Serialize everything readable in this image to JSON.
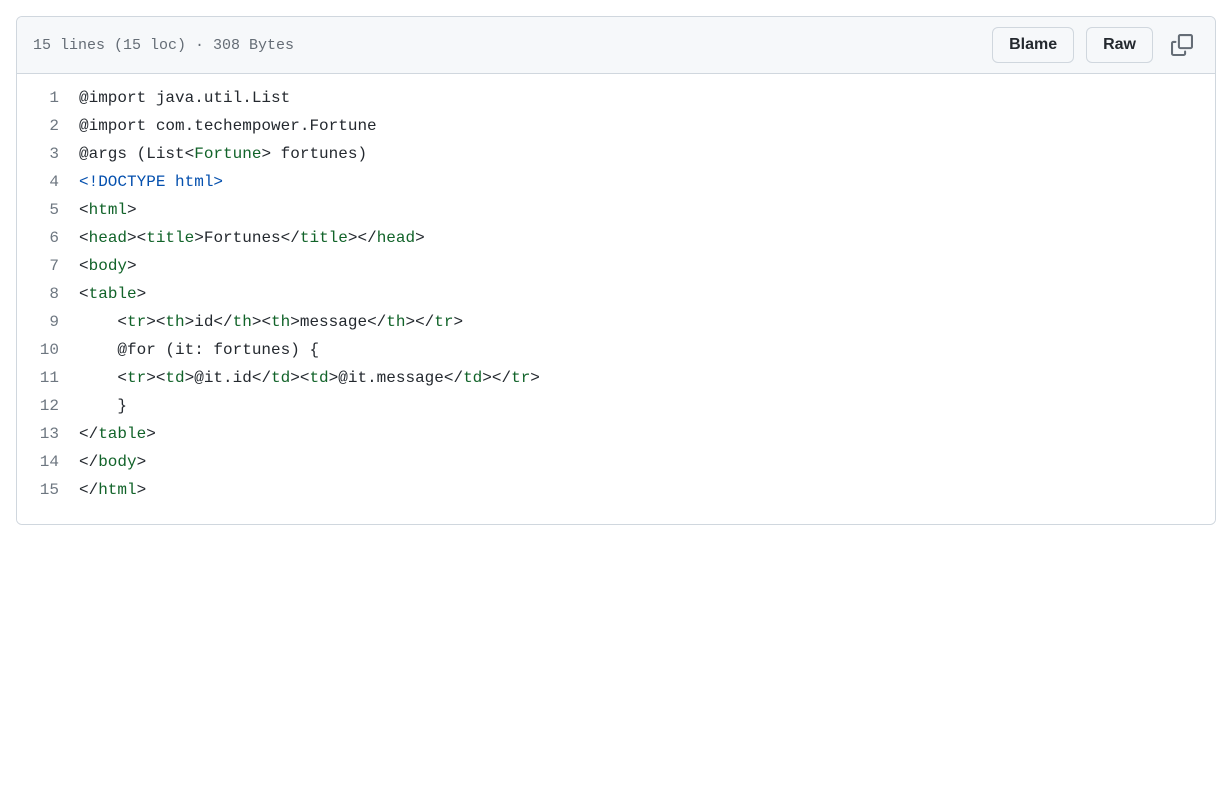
{
  "header": {
    "info_text": "15 lines (15 loc) · 308 Bytes",
    "blame_label": "Blame",
    "raw_label": "Raw"
  },
  "code": {
    "line_count": 15,
    "lines": [
      {
        "num": "1",
        "indent": "",
        "tokens": [
          {
            "t": "txt",
            "v": "@import java.util.List"
          }
        ]
      },
      {
        "num": "2",
        "indent": "",
        "tokens": [
          {
            "t": "txt",
            "v": "@import com.techempower.Fortune"
          }
        ]
      },
      {
        "num": "3",
        "indent": "",
        "tokens": [
          {
            "t": "txt",
            "v": "@args (List<"
          },
          {
            "t": "ent",
            "v": "Fortune"
          },
          {
            "t": "txt",
            "v": "> fortunes)"
          }
        ]
      },
      {
        "num": "4",
        "indent": "",
        "tokens": [
          {
            "t": "doc",
            "v": "<!DOCTYPE html>"
          }
        ]
      },
      {
        "num": "5",
        "indent": "",
        "tokens": [
          {
            "t": "txt",
            "v": "<"
          },
          {
            "t": "ent",
            "v": "html"
          },
          {
            "t": "txt",
            "v": ">"
          }
        ]
      },
      {
        "num": "6",
        "indent": "",
        "tokens": [
          {
            "t": "txt",
            "v": "<"
          },
          {
            "t": "ent",
            "v": "head"
          },
          {
            "t": "txt",
            "v": "><"
          },
          {
            "t": "ent",
            "v": "title"
          },
          {
            "t": "txt",
            "v": ">Fortunes</"
          },
          {
            "t": "ent",
            "v": "title"
          },
          {
            "t": "txt",
            "v": "></"
          },
          {
            "t": "ent",
            "v": "head"
          },
          {
            "t": "txt",
            "v": ">"
          }
        ]
      },
      {
        "num": "7",
        "indent": "",
        "tokens": [
          {
            "t": "txt",
            "v": "<"
          },
          {
            "t": "ent",
            "v": "body"
          },
          {
            "t": "txt",
            "v": ">"
          }
        ]
      },
      {
        "num": "8",
        "indent": "",
        "tokens": [
          {
            "t": "txt",
            "v": "<"
          },
          {
            "t": "ent",
            "v": "table"
          },
          {
            "t": "txt",
            "v": ">"
          }
        ]
      },
      {
        "num": "9",
        "indent": "    ",
        "tokens": [
          {
            "t": "txt",
            "v": "<"
          },
          {
            "t": "ent",
            "v": "tr"
          },
          {
            "t": "txt",
            "v": "><"
          },
          {
            "t": "ent",
            "v": "th"
          },
          {
            "t": "txt",
            "v": ">id</"
          },
          {
            "t": "ent",
            "v": "th"
          },
          {
            "t": "txt",
            "v": "><"
          },
          {
            "t": "ent",
            "v": "th"
          },
          {
            "t": "txt",
            "v": ">message</"
          },
          {
            "t": "ent",
            "v": "th"
          },
          {
            "t": "txt",
            "v": "></"
          },
          {
            "t": "ent",
            "v": "tr"
          },
          {
            "t": "txt",
            "v": ">"
          }
        ]
      },
      {
        "num": "10",
        "indent": "    ",
        "tokens": [
          {
            "t": "txt",
            "v": "@for (it: fortunes) {"
          }
        ]
      },
      {
        "num": "11",
        "indent": "    ",
        "tokens": [
          {
            "t": "txt",
            "v": "<"
          },
          {
            "t": "ent",
            "v": "tr"
          },
          {
            "t": "txt",
            "v": "><"
          },
          {
            "t": "ent",
            "v": "td"
          },
          {
            "t": "txt",
            "v": ">@it.id</"
          },
          {
            "t": "ent",
            "v": "td"
          },
          {
            "t": "txt",
            "v": "><"
          },
          {
            "t": "ent",
            "v": "td"
          },
          {
            "t": "txt",
            "v": ">@it.message</"
          },
          {
            "t": "ent",
            "v": "td"
          },
          {
            "t": "txt",
            "v": "></"
          },
          {
            "t": "ent",
            "v": "tr"
          },
          {
            "t": "txt",
            "v": ">"
          }
        ]
      },
      {
        "num": "12",
        "indent": "    ",
        "tokens": [
          {
            "t": "txt",
            "v": "}"
          }
        ]
      },
      {
        "num": "13",
        "indent": "",
        "tokens": [
          {
            "t": "txt",
            "v": "</"
          },
          {
            "t": "ent",
            "v": "table"
          },
          {
            "t": "txt",
            "v": ">"
          }
        ]
      },
      {
        "num": "14",
        "indent": "",
        "tokens": [
          {
            "t": "txt",
            "v": "</"
          },
          {
            "t": "ent",
            "v": "body"
          },
          {
            "t": "txt",
            "v": ">"
          }
        ]
      },
      {
        "num": "15",
        "indent": "",
        "tokens": [
          {
            "t": "txt",
            "v": "</"
          },
          {
            "t": "ent",
            "v": "html"
          },
          {
            "t": "txt",
            "v": ">"
          }
        ]
      }
    ]
  }
}
